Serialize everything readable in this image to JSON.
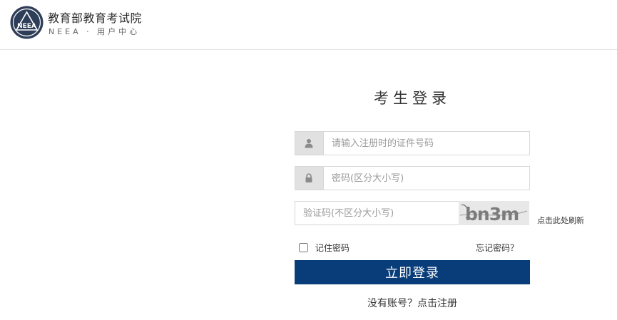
{
  "header": {
    "logo_text": "NEEA",
    "org_title": "教育部教育考试院",
    "org_subtitle": "NEEA · 用户中心"
  },
  "login": {
    "title": "考生登录",
    "id_placeholder": "请输入注册时的证件号码",
    "password_placeholder": "密码(区分大小写)",
    "captcha_placeholder": "验证码(不区分大小写)",
    "captcha_text": "bn3m",
    "refresh_label": "点击此处刷新",
    "remember_label": "记住密码",
    "forgot_label": "忘记密码？",
    "submit_label": "立即登录",
    "register_label": "没有账号？点击注册"
  },
  "colors": {
    "primary": "#083d7a",
    "icon_bg": "#e1e1e1"
  },
  "icons": {
    "id_field": "user-icon",
    "password_field": "lock-icon"
  }
}
